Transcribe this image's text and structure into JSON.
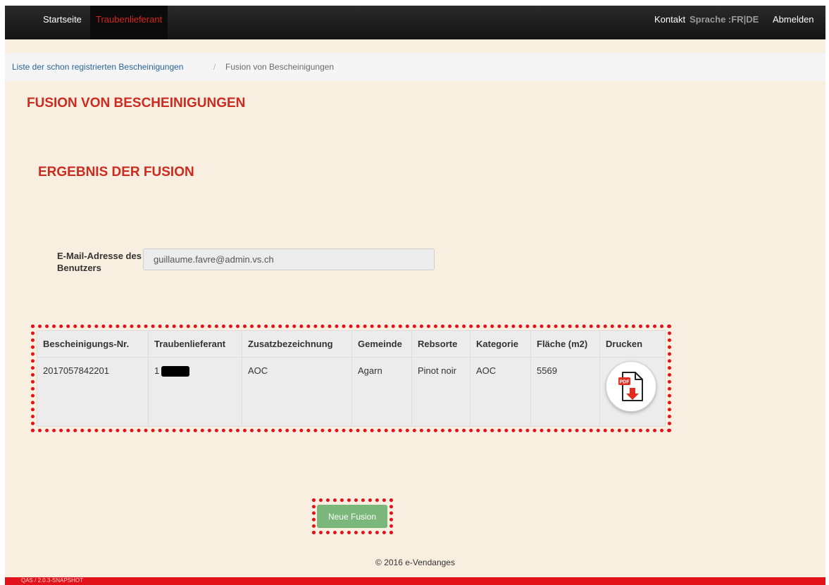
{
  "nav": {
    "home": "Startseite",
    "supplier": "Traubenlieferant",
    "contact": "Kontakt",
    "language": "Sprache :FR|DE",
    "logout": "Abmelden"
  },
  "breadcrumb": {
    "link": "Liste der schon registrierten Bescheinigungen",
    "separator": "/",
    "current": "Fusion von Bescheinigungen"
  },
  "page_title": "FUSION VON BESCHEINIGUNGEN",
  "section_title": "ERGEBNIS DER FUSION",
  "email": {
    "label": "E-Mail-Adresse des Benutzers",
    "value": "guillaume.favre@admin.vs.ch"
  },
  "table": {
    "headers": [
      "Bescheinigungs-Nr.",
      "Traubenlieferant",
      "Zusatzbezeichnung",
      "Gemeinde",
      "Rebsorte",
      "Kategorie",
      "Fläche (m2)",
      "Drucken"
    ],
    "rows": [
      {
        "nr": "2017057842201",
        "supplier": "1",
        "designation": "AOC",
        "commune": "Agarn",
        "variety": "Pinot noir",
        "category": "AOC",
        "area": "5569"
      }
    ],
    "print_icon": "pdf-download-icon"
  },
  "actions": {
    "new_fusion": "Neue Fusion"
  },
  "footer": "© 2016 e-Vendanges",
  "version": "QAS / 2.0.3-SNAPSHOT",
  "colors": {
    "accent_red": "#cc2b1f",
    "highlight_red": "#e4101a",
    "button_green": "#7bb77b",
    "background": "#f9efe0"
  }
}
